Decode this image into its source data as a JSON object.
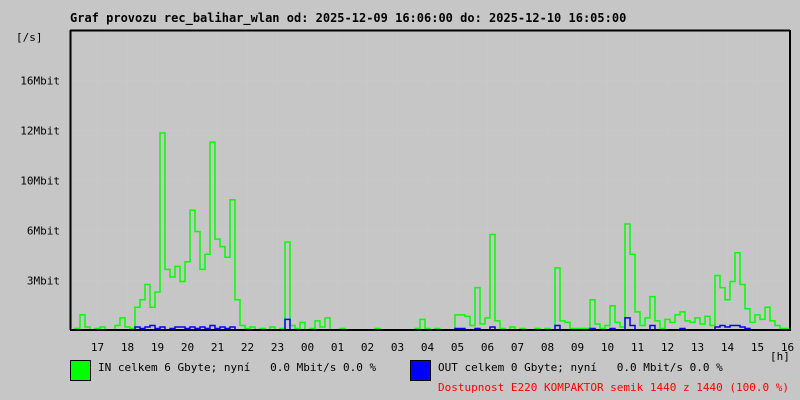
{
  "title": "Graf provozu rec_balihar_wlan od: 2025-12-09 16:06:00 do: 2025-12-10 16:05:00",
  "legend": {
    "in_text": "IN celkem 6 Gbyte; nyní   0.0 Mbit/s 0.0 %",
    "out_text": "OUT celkem 0 Gbyte; nyní   0.0 Mbit/s 0.0 %",
    "availability": "Dostupnost E220 KOMPAKTOR semik 1440 z 1440 (100.0 %)"
  },
  "colors": {
    "in": "#00ff00",
    "out": "#0000ff",
    "availability": "#ff0000",
    "grid": "#c8c8c8"
  },
  "chart_data": {
    "type": "line",
    "title": "Graf provozu rec_balihar_wlan od: 2025-12-09 16:06:00 do: 2025-12-10 16:05:00",
    "ylabel": "[/s]",
    "xlabel": "[h]",
    "ylim": [
      0,
      19.8
    ],
    "xlim_hours": [
      16.1,
      40.1
    ],
    "grid": true,
    "x_ticks": [
      "17",
      "18",
      "19",
      "20",
      "21",
      "22",
      "23",
      "00",
      "01",
      "02",
      "03",
      "04",
      "05",
      "06",
      "07",
      "08",
      "09",
      "10",
      "11",
      "12",
      "13",
      "14",
      "15",
      "16"
    ],
    "y_ticks": [
      {
        "label": "3Mbit",
        "value": 3.3
      },
      {
        "label": "6Mbit",
        "value": 6.6
      },
      {
        "label": "10Mbit",
        "value": 9.9
      },
      {
        "label": "12Mbit",
        "value": 13.2
      },
      {
        "label": "16Mbit",
        "value": 16.5
      }
    ],
    "sample_interval_minutes": 10,
    "series": [
      {
        "name": "IN",
        "unit": "Mbit/s",
        "values": [
          0,
          0.1,
          1.0,
          0.2,
          0,
          0.1,
          0.2,
          0,
          0,
          0.3,
          0.8,
          0.2,
          0.1,
          1.5,
          2.0,
          3.0,
          1.5,
          2.5,
          13.0,
          4.0,
          3.5,
          4.2,
          3.2,
          4.5,
          7.9,
          6.5,
          4.0,
          5.0,
          12.4,
          6.0,
          5.5,
          4.8,
          8.6,
          2.0,
          0.3,
          0.1,
          0.2,
          0,
          0.1,
          0,
          0.2,
          0,
          0.1,
          5.8,
          0.3,
          0.1,
          0.5,
          0,
          0.1,
          0.6,
          0.2,
          0.8,
          0,
          0,
          0.1,
          0,
          0,
          0,
          0,
          0,
          0,
          0.1,
          0,
          0,
          0,
          0,
          0,
          0,
          0,
          0.1,
          0.7,
          0.1,
          0,
          0.1,
          0,
          0,
          0,
          1.0,
          1.0,
          0.9,
          0.3,
          2.8,
          0.4,
          0.8,
          6.3,
          0.6,
          0.1,
          0,
          0.2,
          0,
          0.1,
          0,
          0,
          0.1,
          0,
          0.1,
          0,
          4.1,
          0.6,
          0.5,
          0.1,
          0.1,
          0.1,
          0.1,
          2.0,
          0.4,
          0.1,
          0.3,
          1.6,
          0.5,
          0.2,
          7.0,
          5.0,
          1.2,
          0.3,
          0.8,
          2.2,
          0.6,
          0.1,
          0.7,
          0.5,
          1.0,
          1.2,
          0.6,
          0.5,
          0.8,
          0.4,
          0.9,
          0.3,
          3.6,
          2.8,
          2.0,
          3.2,
          5.1,
          3.0,
          1.4,
          0.5,
          1.0,
          0.7,
          1.5,
          0.6,
          0.3,
          0.1,
          0.1
        ]
      },
      {
        "name": "OUT",
        "unit": "Mbit/s",
        "values": [
          0,
          0,
          0,
          0,
          0,
          0,
          0,
          0,
          0,
          0,
          0,
          0,
          0,
          0.2,
          0.1,
          0.2,
          0.3,
          0.1,
          0.2,
          0,
          0.1,
          0.2,
          0.2,
          0.1,
          0.2,
          0.1,
          0.2,
          0.1,
          0.3,
          0.1,
          0.2,
          0.1,
          0.2,
          0,
          0,
          0,
          0,
          0,
          0,
          0,
          0,
          0,
          0,
          0.7,
          0,
          0,
          0,
          0,
          0,
          0,
          0,
          0,
          0,
          0,
          0,
          0,
          0,
          0,
          0,
          0,
          0,
          0,
          0,
          0,
          0,
          0,
          0,
          0,
          0,
          0,
          0,
          0,
          0,
          0,
          0,
          0,
          0,
          0.1,
          0.1,
          0,
          0,
          0.1,
          0,
          0,
          0.2,
          0,
          0,
          0,
          0,
          0,
          0,
          0,
          0,
          0,
          0,
          0,
          0,
          0.3,
          0,
          0,
          0,
          0,
          0,
          0,
          0.1,
          0,
          0,
          0,
          0.1,
          0,
          0,
          0.8,
          0.3,
          0,
          0,
          0,
          0.3,
          0,
          0,
          0,
          0,
          0,
          0.1,
          0,
          0,
          0,
          0,
          0,
          0,
          0.2,
          0.3,
          0.2,
          0.3,
          0.3,
          0.2,
          0.1,
          0,
          0,
          0,
          0,
          0,
          0,
          0,
          0
        ]
      }
    ]
  }
}
